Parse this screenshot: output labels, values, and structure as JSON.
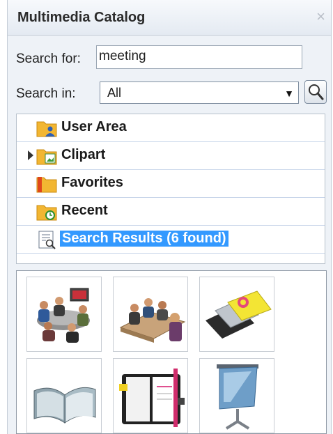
{
  "panel": {
    "title": "Multimedia Catalog",
    "close_glyph": "×"
  },
  "search": {
    "label": "Search for:",
    "value": "meeting"
  },
  "scope": {
    "label": "Search in:",
    "selected": "All",
    "arrow_glyph": "▼"
  },
  "tree": {
    "items": [
      {
        "label": "User Area",
        "icon": "user-folder-icon",
        "expandable": false
      },
      {
        "label": "Clipart",
        "icon": "clipart-folder-icon",
        "expandable": true
      },
      {
        "label": "Favorites",
        "icon": "favorites-folder-icon",
        "expandable": false
      },
      {
        "label": "Recent",
        "icon": "recent-folder-icon",
        "expandable": false
      },
      {
        "label": "Search Results (6 found)",
        "icon": "search-results-icon",
        "expandable": false,
        "selected": true
      }
    ]
  },
  "results": [
    {
      "icon": "video-conference-meeting-icon"
    },
    {
      "icon": "business-meeting-icon"
    },
    {
      "icon": "business-cards-icon"
    },
    {
      "icon": "open-notebook-icon"
    },
    {
      "icon": "planner-organizer-icon"
    },
    {
      "icon": "projection-screen-icon"
    }
  ],
  "colors": {
    "selection": "#3399ff",
    "folder": "#f2b632"
  }
}
